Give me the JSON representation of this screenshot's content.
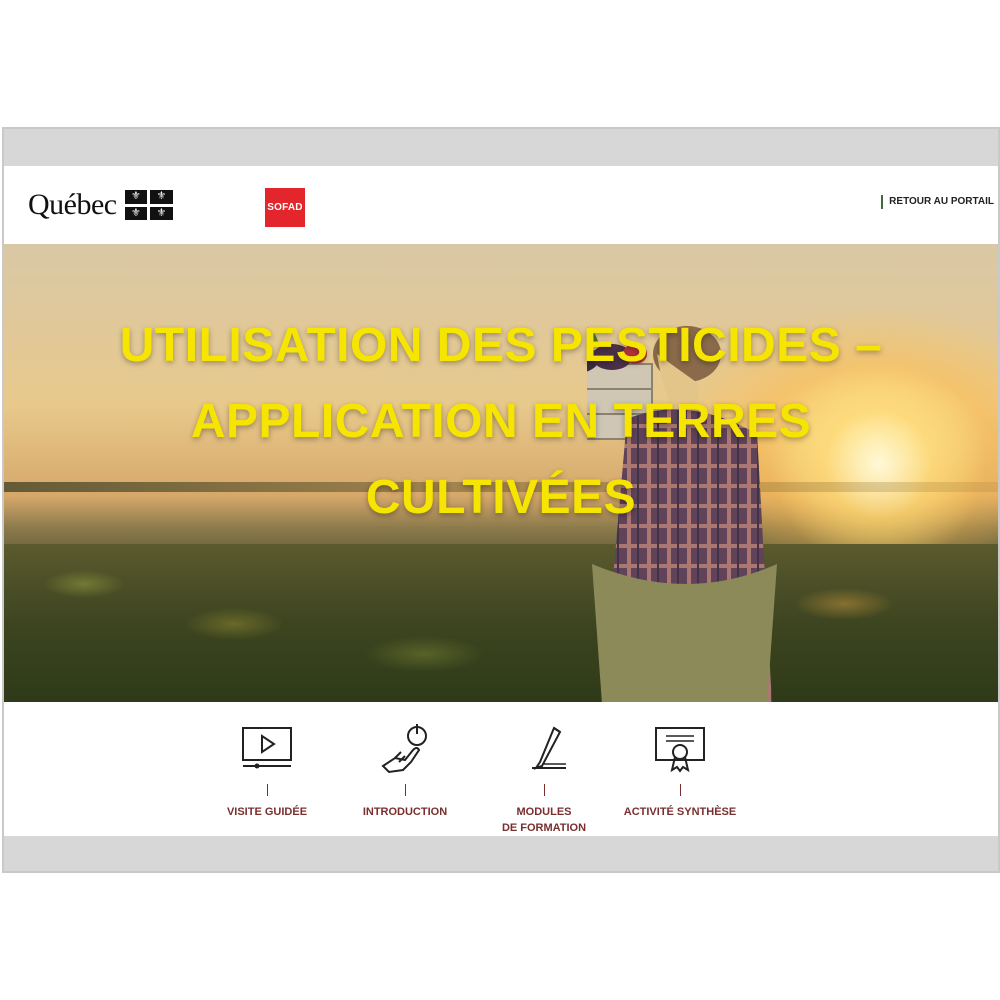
{
  "header": {
    "quebec_wordmark": "Québec",
    "sofad_logo": "SOFAD",
    "portal_link": "RETOUR AU PORTAIL"
  },
  "hero": {
    "title": "UTILISATION DES PESTICIDES – APPLICATION EN TERRES CULTIVÉES"
  },
  "nav": {
    "items": [
      {
        "label": "VISITE GUIDÉE",
        "icon": "video-play-icon"
      },
      {
        "label": "INTRODUCTION",
        "icon": "touch-hand-icon"
      },
      {
        "label": "MODULES\nDE FORMATION",
        "icon": "pencil-icon"
      },
      {
        "label": "ACTIVITÉ SYNTHÈSE",
        "icon": "certificate-icon"
      }
    ]
  },
  "colors": {
    "title_yellow": "#f6e500",
    "nav_label": "#7a2e2e",
    "sofad_red": "#e3262b",
    "portal_accent": "#3d6b3d"
  }
}
